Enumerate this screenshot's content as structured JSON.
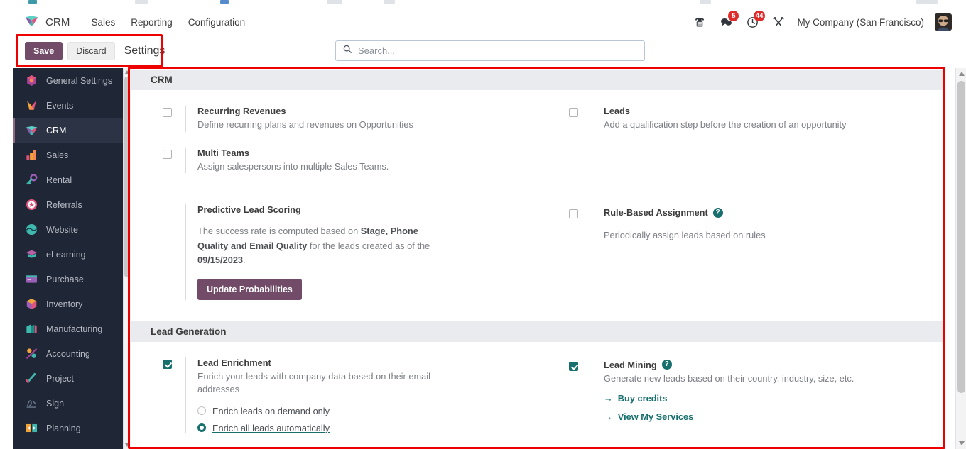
{
  "navbar": {
    "brand": "CRM",
    "brand_icon": "crm-diamond-icon",
    "links": [
      {
        "label": "Sales"
      },
      {
        "label": "Reporting"
      },
      {
        "label": "Configuration"
      }
    ],
    "icons": [
      {
        "name": "phone-icon",
        "badge": null
      },
      {
        "name": "messages-icon",
        "badge": "5"
      },
      {
        "name": "activities-clock-icon",
        "badge": "44"
      },
      {
        "name": "tools-wrench-icon",
        "badge": null
      }
    ],
    "company": "My Company (San Francisco)",
    "avatar": "user-avatar"
  },
  "control_panel": {
    "save_label": "Save",
    "discard_label": "Discard",
    "title": "Settings"
  },
  "search": {
    "placeholder": "Search...",
    "value": ""
  },
  "sidebar": {
    "items": [
      {
        "label": "General Settings",
        "icon": "settings-gear-icon",
        "active": false
      },
      {
        "label": "Events",
        "icon": "events-icon",
        "active": false
      },
      {
        "label": "CRM",
        "icon": "crm-diamond-icon",
        "active": true
      },
      {
        "label": "Sales",
        "icon": "sales-chart-icon",
        "active": false
      },
      {
        "label": "Rental",
        "icon": "rental-key-icon",
        "active": false
      },
      {
        "label": "Referrals",
        "icon": "referrals-badge-icon",
        "active": false
      },
      {
        "label": "Website",
        "icon": "website-globe-icon",
        "active": false
      },
      {
        "label": "eLearning",
        "icon": "elearning-cap-icon",
        "active": false
      },
      {
        "label": "Purchase",
        "icon": "purchase-card-icon",
        "active": false
      },
      {
        "label": "Inventory",
        "icon": "inventory-box-icon",
        "active": false
      },
      {
        "label": "Manufacturing",
        "icon": "manufacturing-factory-icon",
        "active": false
      },
      {
        "label": "Accounting",
        "icon": "accounting-icon",
        "active": false
      },
      {
        "label": "Project",
        "icon": "project-check-icon",
        "active": false
      },
      {
        "label": "Sign",
        "icon": "sign-pen-icon",
        "active": false
      },
      {
        "label": "Planning",
        "icon": "planning-arrows-icon",
        "active": false
      }
    ]
  },
  "sections": {
    "crm": {
      "header": "CRM",
      "recurring_revenues": {
        "title": "Recurring Revenues",
        "desc": "Define recurring plans and revenues on Opportunities",
        "checked": false
      },
      "leads": {
        "title": "Leads",
        "desc": "Add a qualification step before the creation of an opportunity",
        "checked": false
      },
      "multi_teams": {
        "title": "Multi Teams",
        "desc": "Assign salespersons into multiple Sales Teams.",
        "checked": false
      },
      "predictive_lead_scoring": {
        "title": "Predictive Lead Scoring",
        "text_1": "The success rate is computed based on ",
        "text_bold_1": "Stage, Phone Quality and Email Quality",
        "text_2": " for the leads created as of the ",
        "text_bold_2": "09/15/2023",
        "text_3": ".",
        "button": "Update Probabilities"
      },
      "rule_based_assignment": {
        "title": "Rule-Based Assignment",
        "desc": "Periodically assign leads based on rules",
        "checked": false,
        "help": "?"
      }
    },
    "lead_generation": {
      "header": "Lead Generation",
      "lead_enrichment": {
        "title": "Lead Enrichment",
        "desc": "Enrich your leads with company data based on their email addresses",
        "checked": true,
        "options": [
          {
            "label": "Enrich leads on demand only",
            "selected": false
          },
          {
            "label": "Enrich all leads automatically",
            "selected": true
          }
        ]
      },
      "lead_mining": {
        "title": "Lead Mining",
        "desc": "Generate new leads based on their country, industry, size, etc.",
        "checked": true,
        "help": "?",
        "links": [
          {
            "label": "Buy credits",
            "arrow": "→"
          },
          {
            "label": "View My Services",
            "arrow": "→"
          }
        ]
      }
    }
  },
  "colors": {
    "accent_purple": "#714b67",
    "accent_teal": "#17706e",
    "badge_red": "#e02b2b",
    "sidebar_bg": "#1f2636",
    "annotation_red": "#ee0000"
  }
}
